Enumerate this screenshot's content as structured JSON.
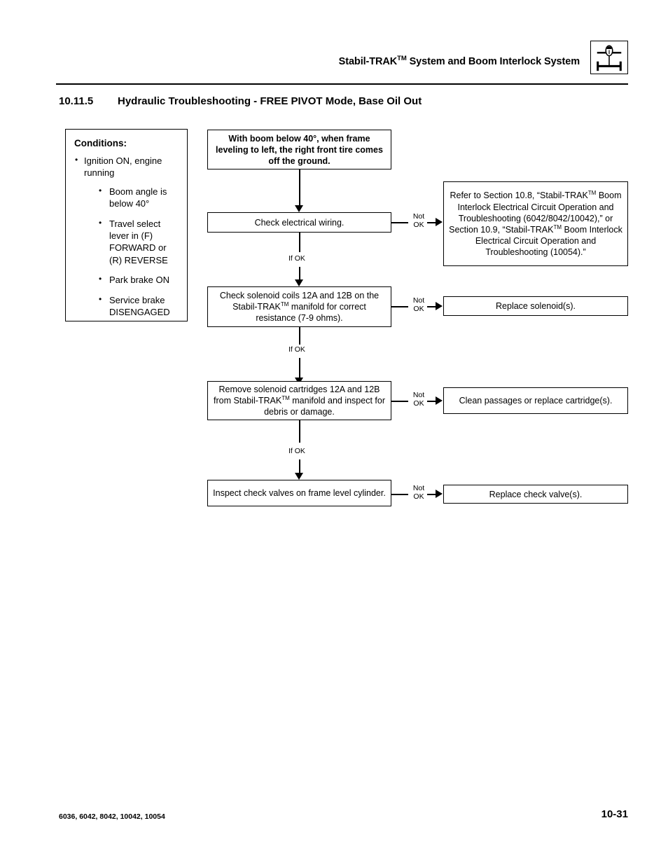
{
  "header": {
    "title_prefix": "Stabil-TRAK",
    "title_tm": "TM",
    "title_suffix": " System and Boom Interlock System",
    "icon_name": "frame-level-axle-icon"
  },
  "section": {
    "number": "10.11.5",
    "title": "Hydraulic Troubleshooting - FREE PIVOT Mode, Base Oil Out"
  },
  "conditions": {
    "heading": "Conditions:",
    "items": [
      "Ignition ON, engine running"
    ],
    "subitems": [
      "Boom angle is below 40°",
      "Travel select lever in (F) FORWARD or (R) REVERSE",
      "Park brake ON",
      "Service brake DISENGAGED"
    ]
  },
  "flow": {
    "start": "With boom below 40°, when frame leveling to left, the right front tire comes off the ground.",
    "steps": [
      {
        "text": "Check electrical wiring.",
        "not_ok_label": "Not\nOK",
        "if_ok_label": "If OK"
      },
      {
        "text_part1": "Check solenoid coils 12A and 12B on the Stabil-TRAK",
        "text_tm": "TM",
        "text_part2": " manifold for correct resistance (7-9 ohms).",
        "not_ok_label": "Not\nOK",
        "if_ok_label": "If OK"
      },
      {
        "text_part1": "Remove solenoid cartridges 12A and 12B from Stabil-TRAK",
        "text_tm": "TM",
        "text_part2": " manifold and inspect for debris or damage.",
        "not_ok_label": "Not\nOK",
        "if_ok_label": "If OK"
      },
      {
        "text": "Inspect check valves on frame level cylinder.",
        "not_ok_label": "Not\nOK",
        "if_ok_label": ""
      }
    ],
    "results": [
      {
        "part1": "Refer to Section 10.8, “Stabil-TRAK",
        "tm1": "TM",
        "part2": " Boom Interlock Electrical Circuit Operation and Troubleshooting (6042/8042/10042),” or Section 10.9, “Stabil-TRAK",
        "tm2": "TM",
        "part3": " Boom Interlock Electrical Circuit Operation and Troubleshooting (10054).”"
      },
      {
        "text": "Replace solenoid(s)."
      },
      {
        "text": "Clean passages or replace cartridge(s)."
      },
      {
        "text": "Replace check valve(s)."
      }
    ]
  },
  "footer": {
    "models": "6036, 6042, 8042, 10042, 10054",
    "page": "10-31"
  }
}
